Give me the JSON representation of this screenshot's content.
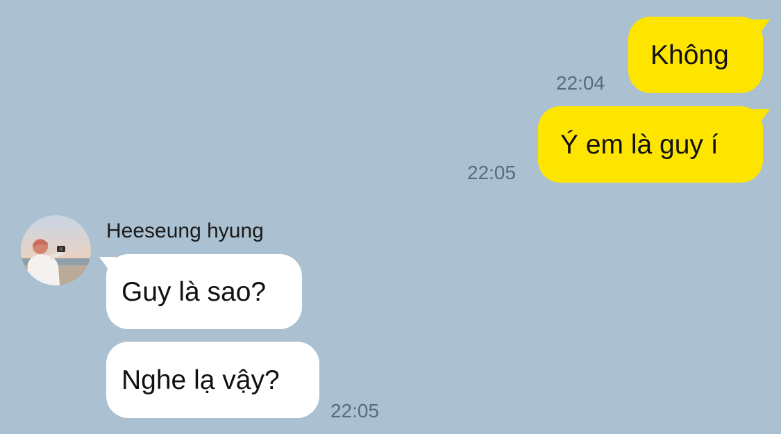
{
  "colors": {
    "background": "#abc1d1",
    "outgoing_bubble": "#fee500",
    "incoming_bubble": "#ffffff",
    "timestamp": "#5a6a78"
  },
  "messages": [
    {
      "direction": "outgoing",
      "text": "Không",
      "time": "22:04"
    },
    {
      "direction": "outgoing",
      "text": "Ý em là guy í",
      "time": "22:05"
    },
    {
      "direction": "incoming",
      "sender": "Heeseung hyung",
      "text": "Guy là sao?"
    },
    {
      "direction": "incoming",
      "text": "Nghe lạ vậy?",
      "time": "22:05"
    }
  ],
  "avatar": {
    "icon": "profile-photo-person-with-camera-at-beach"
  }
}
